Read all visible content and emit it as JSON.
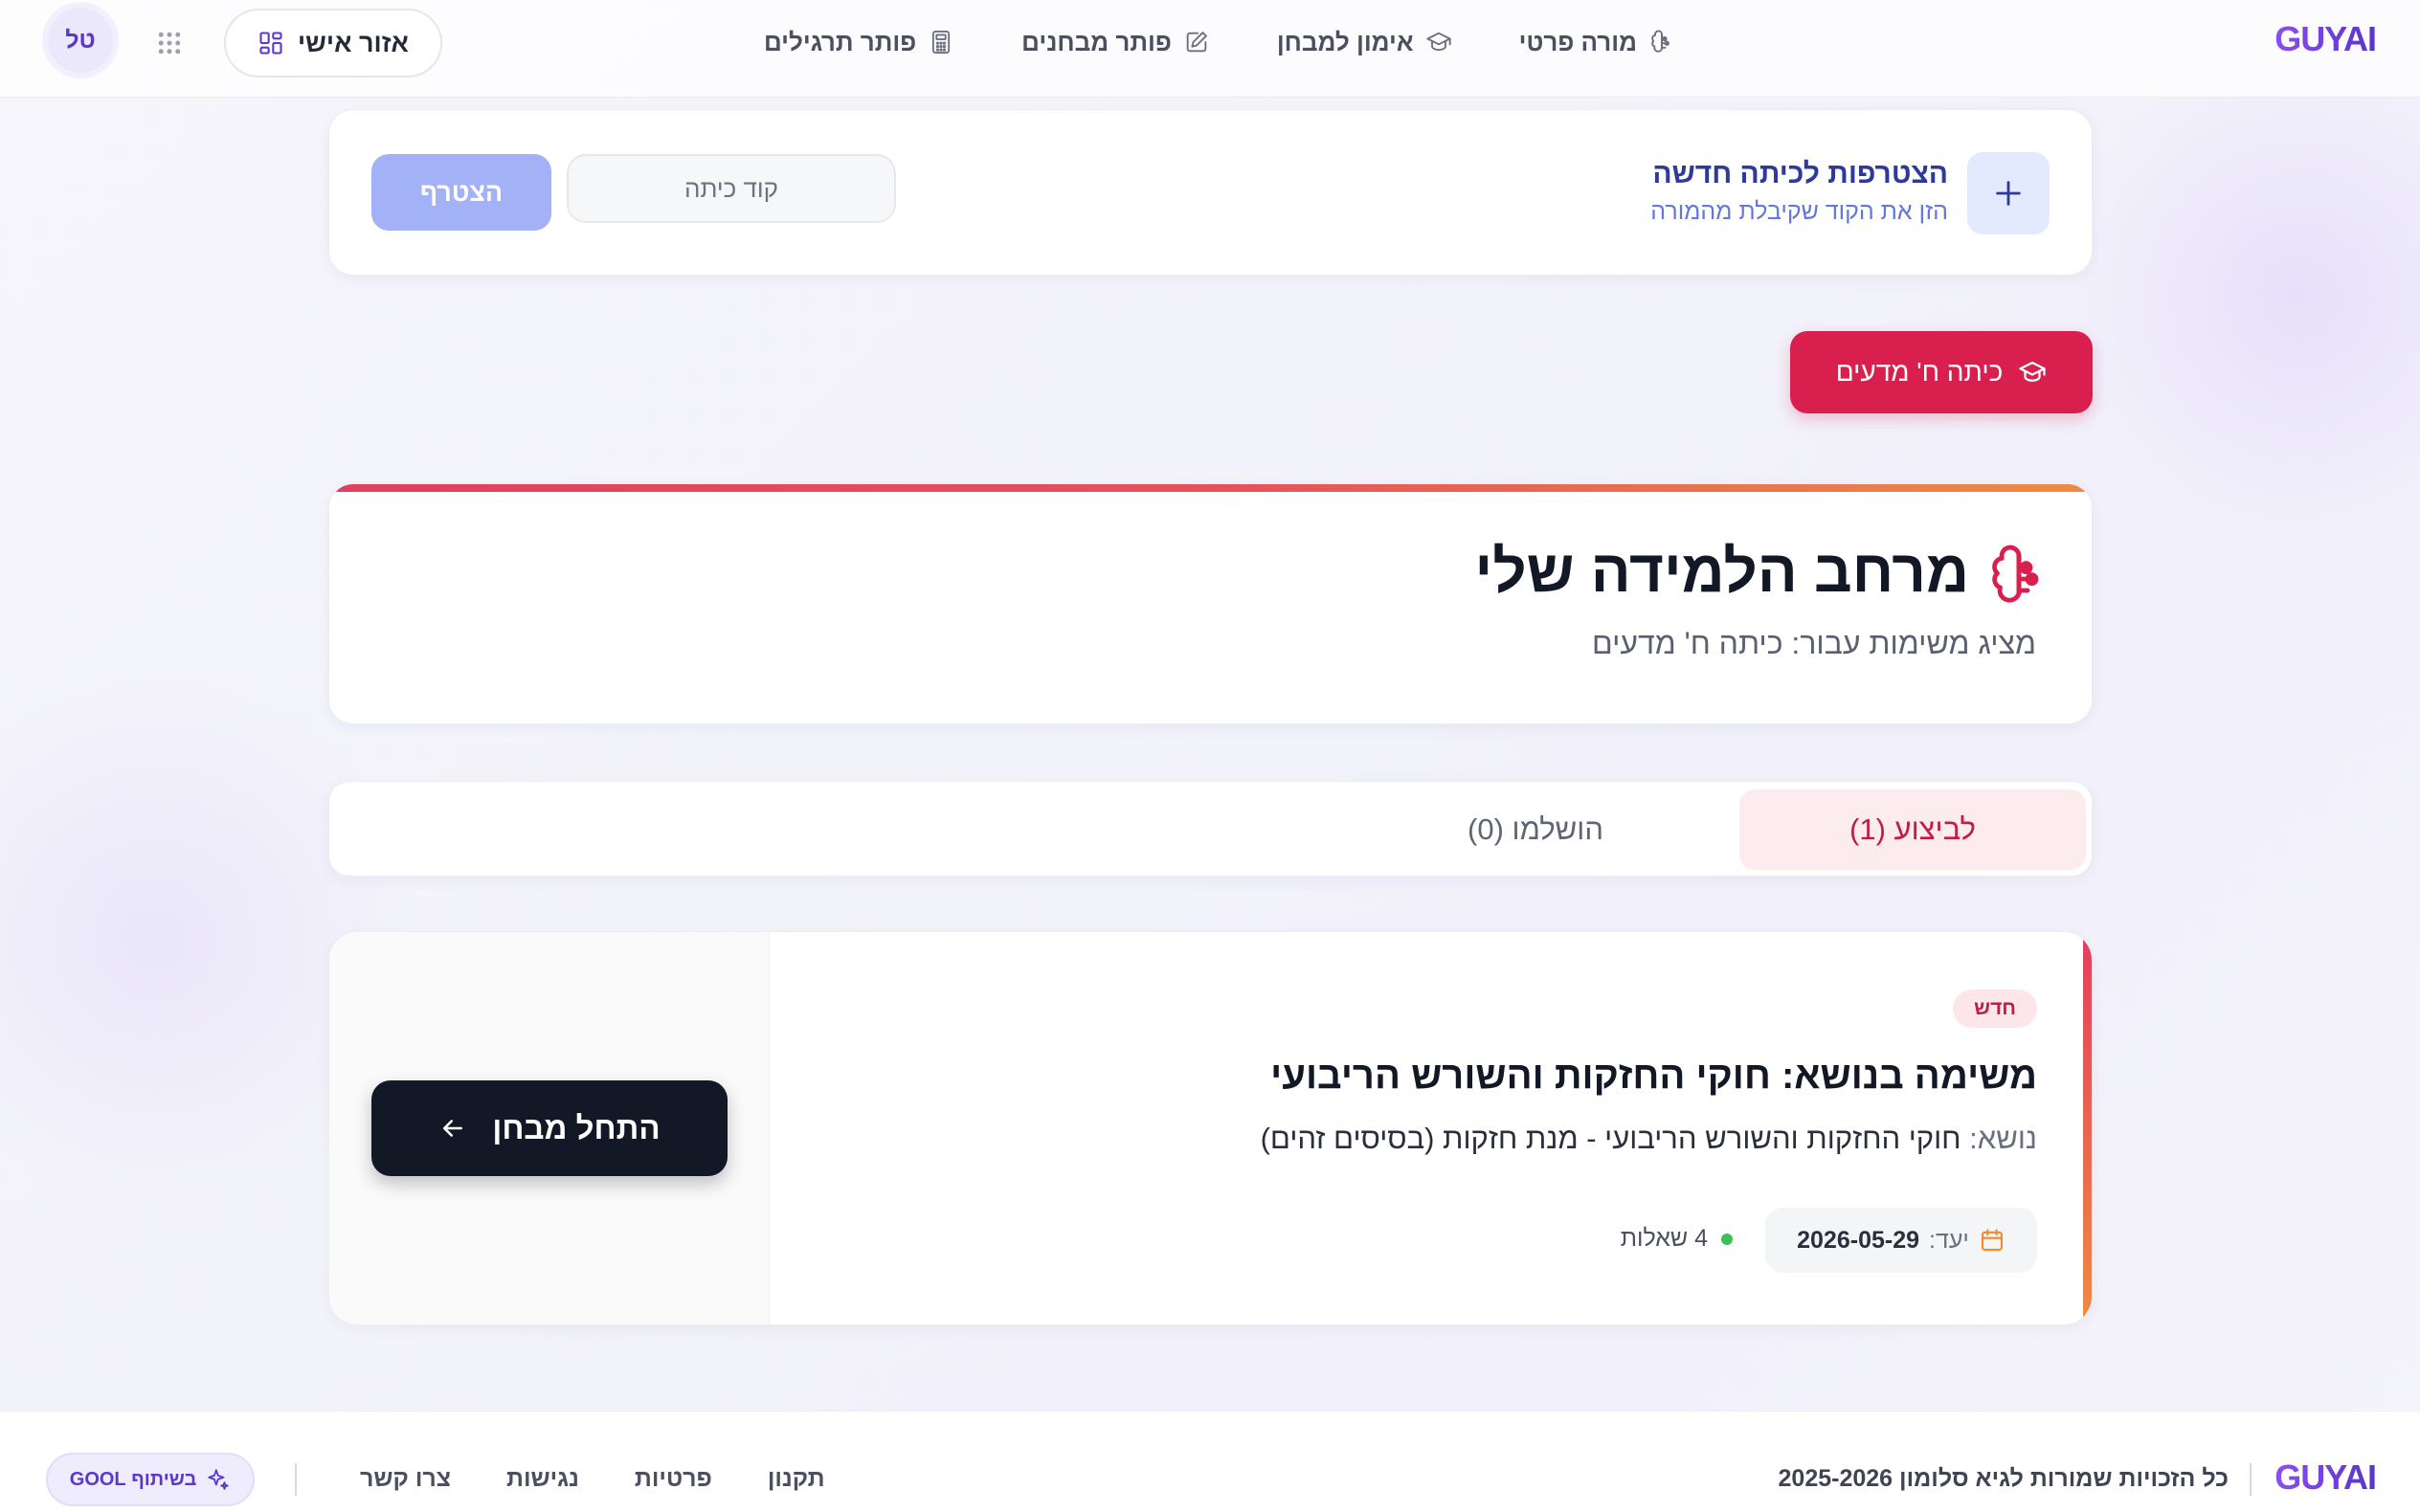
{
  "nav": {
    "brand": "GUYAI",
    "links": [
      {
        "label": "פותר תרגילים",
        "icon": "calculator-icon"
      },
      {
        "label": "פותר מבחנים",
        "icon": "edit-icon"
      },
      {
        "label": "אימון למבחן",
        "icon": "graduation-cap-icon"
      },
      {
        "label": "מורה פרטי",
        "icon": "brain-icon"
      }
    ],
    "personal_area": "אזור אישי",
    "avatar_initials": "טל"
  },
  "join": {
    "title": "הצטרפות לכיתה חדשה",
    "subtitle": "הזן את הקוד שקיבלת מהמורה",
    "code_value": "",
    "code_placeholder": "קוד כיתה",
    "join_button": "הצטרף"
  },
  "class_chip": {
    "label": "כיתה ח' מדעים",
    "color": "#d91f4d"
  },
  "learning_space": {
    "title": "מרחב הלמידה שלי",
    "subtitle": "מציג משימות עבור: כיתה ח' מדעים"
  },
  "tabs": [
    {
      "label": "לביצוע (1)",
      "active": true
    },
    {
      "label": "הושלמו (0)",
      "active": false
    }
  ],
  "task": {
    "badge": "חדש",
    "title": "משימה בנושא: חוקי החזקות והשורש הריבועי",
    "topic_label": "נושא:",
    "topic_value": "חוקי החזקות והשורש הריבועי - מנת חזקות (בסיסים זהים)",
    "due_label": "יעד:",
    "due_date": "2026-05-29",
    "questions": "4 שאלות",
    "start_button": "התחל מבחן"
  },
  "footer": {
    "brand": "GUYAI",
    "copyright": "כל הזכויות שמורות לגיא סלומון 2025-2026",
    "links": [
      "צרו קשר",
      "נגישות",
      "פרטיות",
      "תקנון"
    ],
    "partner_badge": "בשיתוף GOOL"
  },
  "colors": {
    "accent": "#d91f4d",
    "brand_purple": "#6b3fd6",
    "join_button": "#a3b2f6",
    "start_button": "#121826"
  }
}
